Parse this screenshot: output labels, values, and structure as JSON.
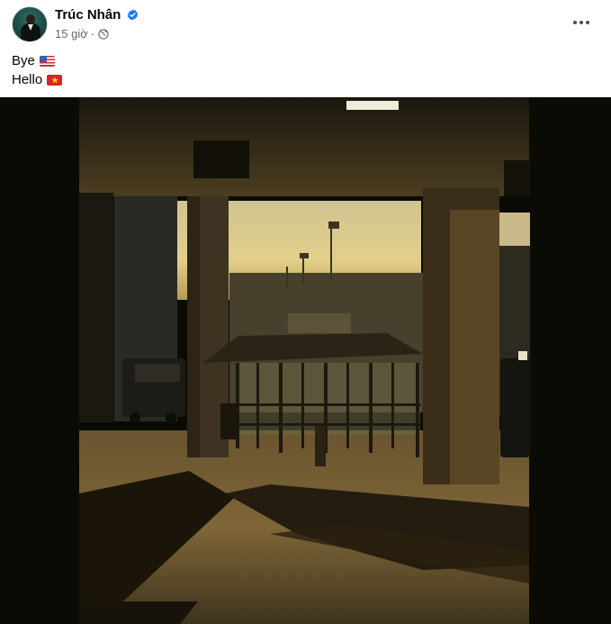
{
  "post": {
    "author": "Trúc Nhân",
    "verified": true,
    "time": "15 giờ",
    "separator": "·",
    "audience_icon": "globe-icon",
    "more_icon": "more-options-icon",
    "lines": [
      {
        "text": "Bye",
        "flag": "us-flag-icon"
      },
      {
        "text": "Hello",
        "flag": "vietnam-flag-icon"
      }
    ]
  },
  "photo": {
    "subject": "Sunset light through an airport terminal curbside canopy with bus shelter and long shadows",
    "colors": {
      "shadow": "#0b0b06",
      "sky": "#d9c98f",
      "light_floor": "#8a6d3a"
    }
  },
  "colors": {
    "text": "#050505",
    "secondary": "#65676b",
    "verified": "#1877f2"
  }
}
